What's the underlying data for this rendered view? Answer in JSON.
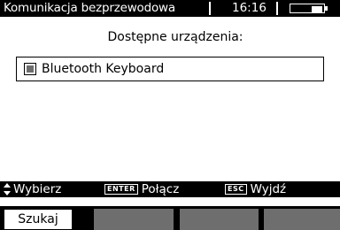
{
  "titlebar": {
    "title": "Komunikacja bezprzewodowa",
    "time": "16:16",
    "battery_level": 0.35,
    "battery_icon": "battery-icon"
  },
  "header": "Dostępne urządzenia:",
  "devices": [
    {
      "label": "Bluetooth Keyboard",
      "checkbox_icon": "checkbox-icon"
    }
  ],
  "hints": {
    "select_icon": "updown-arrows-icon",
    "select": "Wybierz",
    "enter_key": "ENTER",
    "connect": "Połącz",
    "esc_key": "ESC",
    "exit": "Wyjdź"
  },
  "softkeys": [
    "Szukaj",
    "",
    "",
    ""
  ],
  "colors": {
    "bar": "#000000",
    "background": "#ffffff",
    "softkey_empty": "#6e6e6e",
    "checkbox_fill": "#6d6d6d"
  }
}
